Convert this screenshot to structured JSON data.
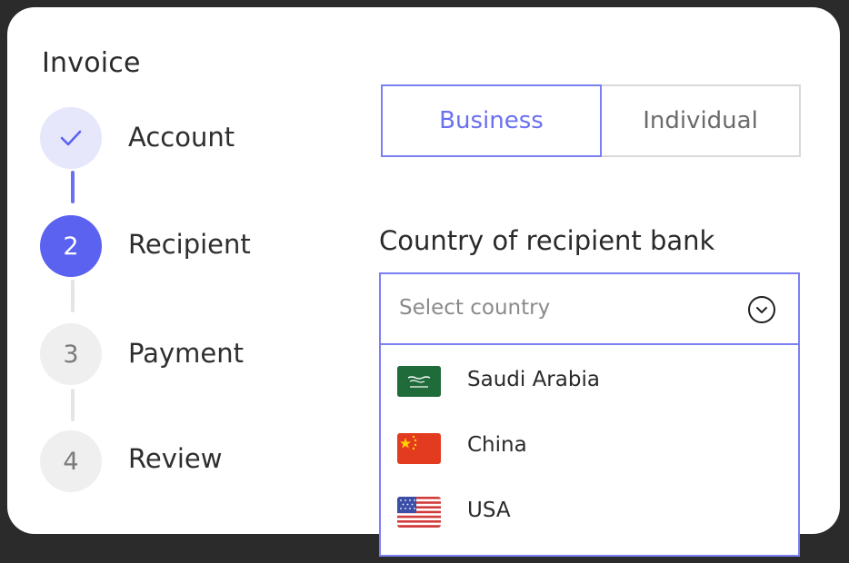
{
  "app": {
    "title": "Invoice"
  },
  "stepper": {
    "steps": [
      {
        "number": "",
        "label": "Account",
        "state": "complete",
        "icon": "checkmark-icon"
      },
      {
        "number": "2",
        "label": "Recipient",
        "state": "active"
      },
      {
        "number": "3",
        "label": "Payment",
        "state": "pending"
      },
      {
        "number": "4",
        "label": "Review",
        "state": "pending"
      }
    ]
  },
  "recipient_type": {
    "options": [
      "Business",
      "Individual"
    ],
    "selected": "Business"
  },
  "country_field": {
    "label": "Country of recipient bank",
    "placeholder": "Select country",
    "icon": "chevron-down-circle-icon",
    "options": [
      {
        "label": "Saudi Arabia",
        "flag": "saudi-arabia-flag-icon"
      },
      {
        "label": "China",
        "flag": "china-flag-icon"
      },
      {
        "label": "USA",
        "flag": "usa-flag-icon"
      }
    ]
  },
  "colors": {
    "accent": "#5b62f0",
    "accent_border": "#7b80f3",
    "background": "#2b2b2b",
    "card": "#ffffff"
  }
}
